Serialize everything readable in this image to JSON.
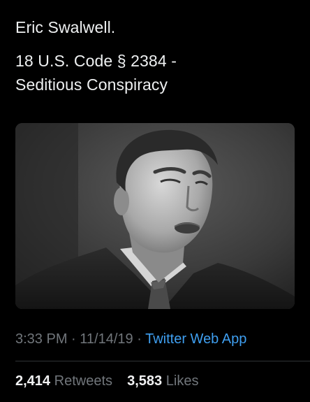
{
  "tweet": {
    "text_line1": "Eric Swalwell.",
    "text_line2": "18 U.S. Code § 2384 -",
    "text_line3": "Seditious Conspiracy",
    "time": "3:33 PM",
    "date": "11/14/19",
    "separator": "·",
    "source": "Twitter Web App",
    "photo_icon": "portrait-photo"
  },
  "stats": {
    "retweets_count": "2,414",
    "retweets_label": "Retweets",
    "likes_count": "3,583",
    "likes_label": "Likes"
  },
  "colors": {
    "background": "#000000",
    "text": "#eef0f1",
    "muted": "#71767b",
    "link": "#3f9ff0"
  }
}
